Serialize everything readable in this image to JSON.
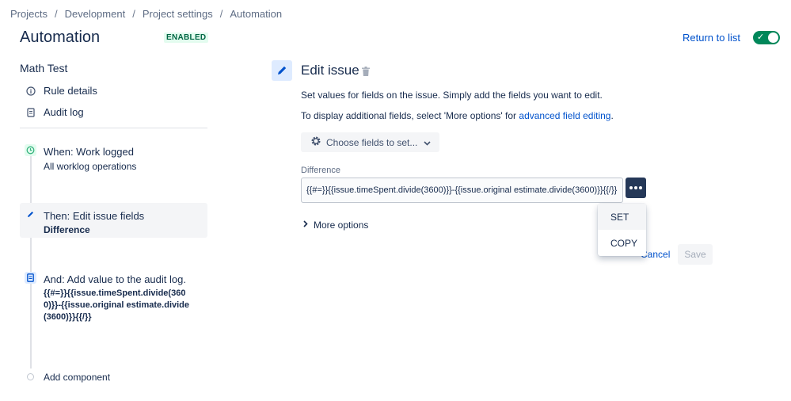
{
  "breadcrumb": {
    "items": [
      "Projects",
      "Development",
      "Project settings",
      "Automation"
    ],
    "separator": "/"
  },
  "header": {
    "title": "Automation",
    "status": "ENABLED",
    "return_label": "Return to list",
    "toggle_on": true
  },
  "sidebar": {
    "rule_name": "Math Test",
    "links": [
      {
        "label": "Rule details",
        "icon": "info-icon"
      },
      {
        "label": "Audit log",
        "icon": "document-icon"
      }
    ],
    "steps": [
      {
        "title": "When: Work logged",
        "sub": "All worklog operations",
        "icon": "clock-icon",
        "color": "#36b37e"
      },
      {
        "title": "Then: Edit issue fields",
        "sub": "Difference",
        "icon": "pencil-icon",
        "color": "#0052cc"
      },
      {
        "title": "And: Add value to the audit log.",
        "sub": "{{#=}}{{issue.timeSpent.divide(3600)}}-{{issue.original estimate.divide(3600)}}{{/}}",
        "icon": "document-icon",
        "color": "#0052cc"
      }
    ],
    "add_component": "Add component"
  },
  "editor": {
    "title": "Edit issue",
    "desc1": "Set values for fields on the issue. Simply add the fields you want to edit.",
    "desc2_prefix": "To display additional fields, select 'More options' for ",
    "desc2_link": "advanced field editing",
    "desc2_suffix": ".",
    "choose_label": "Choose fields to set...",
    "field_label": "Difference",
    "field_value": "{{#=}}{{issue.timeSpent.divide(3600)}}-{{issue.original estimate.divide(3600)}}{{/}}",
    "more_options": "More options",
    "cancel": "Cancel",
    "save": "Save",
    "menu": [
      "SET",
      "COPY"
    ]
  },
  "colors": {
    "accent": "#0052cc",
    "enabled_green": "#00875a",
    "dark_button": "#253858"
  }
}
